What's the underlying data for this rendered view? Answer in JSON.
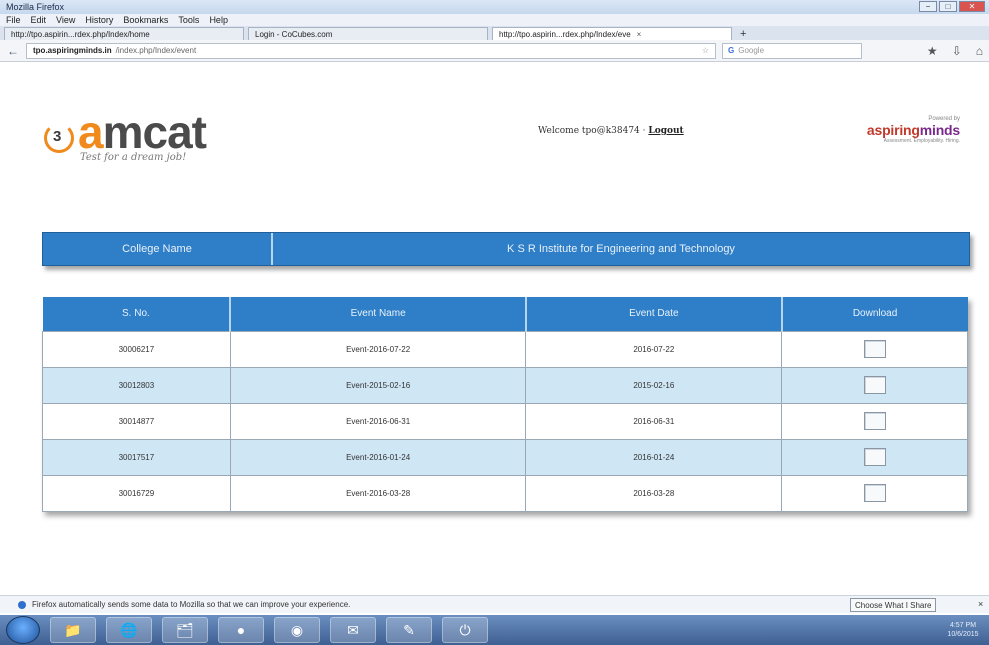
{
  "window": {
    "title": "Mozilla Firefox",
    "minimize": "−",
    "maximize": "□",
    "close": "✕"
  },
  "menu": {
    "items": [
      "File",
      "Edit",
      "View",
      "History",
      "Bookmarks",
      "Tools",
      "Help"
    ]
  },
  "tabs": [
    {
      "label": "http://tpo.aspirin...rdex.php/Index/home"
    },
    {
      "label": "Login - CoCubes.com"
    },
    {
      "label": "http://tpo.aspirin...rdex.php/Index/eve",
      "close": "×"
    }
  ],
  "new_tab": "+",
  "nav": {
    "url_host": "tpo.aspiringminds.in",
    "url_path": "/index.php/Index/event",
    "search_engine": "G",
    "search_placeholder": "Google",
    "back": "←",
    "star": "☆",
    "icons": {
      "home": "⌂",
      "download": "⇩",
      "bookmark": "★"
    }
  },
  "header": {
    "logo_prefix": "a",
    "logo_rest": "mcat",
    "tagline": "Test for a dream job!",
    "welcome": "Welcome tpo@k38474 · ",
    "logout": "Logout",
    "powered_by": "Powered by",
    "brand_a": "aspiring",
    "brand_b": "minds",
    "brand_sub": "Assessment. Employability. Hiring."
  },
  "college": {
    "label": "College Name",
    "value": "K S R Institute for Engineering and Technology"
  },
  "table": {
    "headers": [
      "S. No.",
      "Event Name",
      "Event Date",
      "Download"
    ],
    "rows": [
      {
        "sno": "30006217",
        "name": "Event-2016-07-22",
        "date": "2016-07-22"
      },
      {
        "sno": "30012803",
        "name": "Event-2015-02-16",
        "date": "2015-02-16"
      },
      {
        "sno": "30014877",
        "name": "Event-2016-06-31",
        "date": "2016-06-31"
      },
      {
        "sno": "30017517",
        "name": "Event-2016-01-24",
        "date": "2016-01-24"
      },
      {
        "sno": "30016729",
        "name": "Event-2016-03-28",
        "date": "2016-03-28"
      }
    ]
  },
  "notification": {
    "text": "Firefox automatically sends some data to Mozilla so that we can improve your experience.",
    "button": "Choose What I Share",
    "close": "×"
  },
  "taskbar": {
    "icons": [
      "📁",
      "🌐",
      "🗂",
      "●",
      "◉",
      "✉",
      "✎",
      "⏻"
    ],
    "clock_time": "4:57 PM",
    "clock_date": "10/6/2015"
  }
}
